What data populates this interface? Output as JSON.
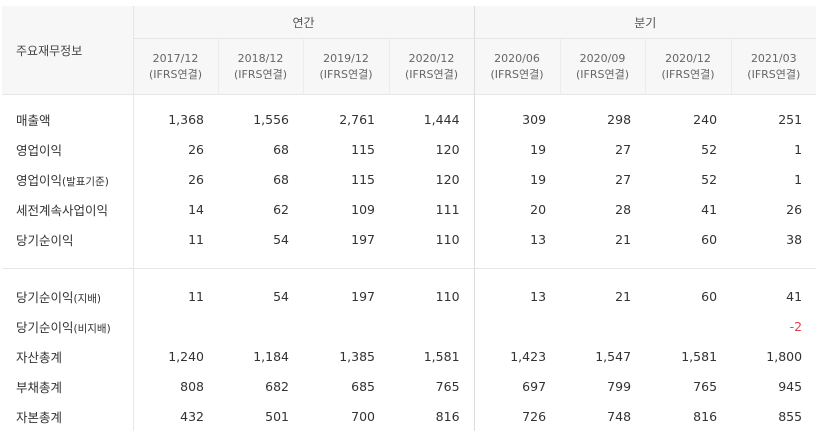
{
  "table": {
    "corner_label": "주요재무정보",
    "groups": [
      {
        "label": "연간",
        "span": 4
      },
      {
        "label": "분기",
        "span": 4
      }
    ],
    "periods": [
      {
        "date": "2017/12",
        "basis": "(IFRS연결)"
      },
      {
        "date": "2018/12",
        "basis": "(IFRS연결)"
      },
      {
        "date": "2019/12",
        "basis": "(IFRS연결)"
      },
      {
        "date": "2020/12",
        "basis": "(IFRS연결)"
      },
      {
        "date": "2020/06",
        "basis": "(IFRS연결)"
      },
      {
        "date": "2020/09",
        "basis": "(IFRS연결)"
      },
      {
        "date": "2020/12",
        "basis": "(IFRS연결)"
      },
      {
        "date": "2021/03",
        "basis": "(IFRS연결)"
      }
    ],
    "section1": [
      {
        "label": "매출액",
        "label_suffix": "",
        "values": [
          "1,368",
          "1,556",
          "2,761",
          "1,444",
          "309",
          "298",
          "240",
          "251"
        ]
      },
      {
        "label": "영업이익",
        "label_suffix": "",
        "values": [
          "26",
          "68",
          "115",
          "120",
          "19",
          "27",
          "52",
          "1"
        ]
      },
      {
        "label": "영업이익",
        "label_suffix": "(발표기준)",
        "values": [
          "26",
          "68",
          "115",
          "120",
          "19",
          "27",
          "52",
          "1"
        ]
      },
      {
        "label": "세전계속사업이익",
        "label_suffix": "",
        "values": [
          "14",
          "62",
          "109",
          "111",
          "20",
          "28",
          "41",
          "26"
        ]
      },
      {
        "label": "당기순이익",
        "label_suffix": "",
        "values": [
          "11",
          "54",
          "197",
          "110",
          "13",
          "21",
          "60",
          "38"
        ]
      }
    ],
    "section2": [
      {
        "label": "당기순이익",
        "label_suffix": "(지배)",
        "values": [
          "11",
          "54",
          "197",
          "110",
          "13",
          "21",
          "60",
          "41"
        ]
      },
      {
        "label": "당기순이익",
        "label_suffix": "(비지배)",
        "values": [
          "",
          "",
          "",
          "",
          "",
          "",
          "",
          "-2"
        ]
      },
      {
        "label": "자산총계",
        "label_suffix": "",
        "values": [
          "1,240",
          "1,184",
          "1,385",
          "1,581",
          "1,423",
          "1,547",
          "1,581",
          "1,800"
        ]
      },
      {
        "label": "부채총계",
        "label_suffix": "",
        "values": [
          "808",
          "682",
          "685",
          "765",
          "697",
          "799",
          "765",
          "945"
        ]
      },
      {
        "label": "자본총계",
        "label_suffix": "",
        "values": [
          "432",
          "501",
          "700",
          "816",
          "726",
          "748",
          "816",
          "855"
        ]
      }
    ],
    "colors": {
      "negative": "#e8414b",
      "header_bg": "#f7f7f7",
      "border": "#e6e6e6"
    }
  }
}
